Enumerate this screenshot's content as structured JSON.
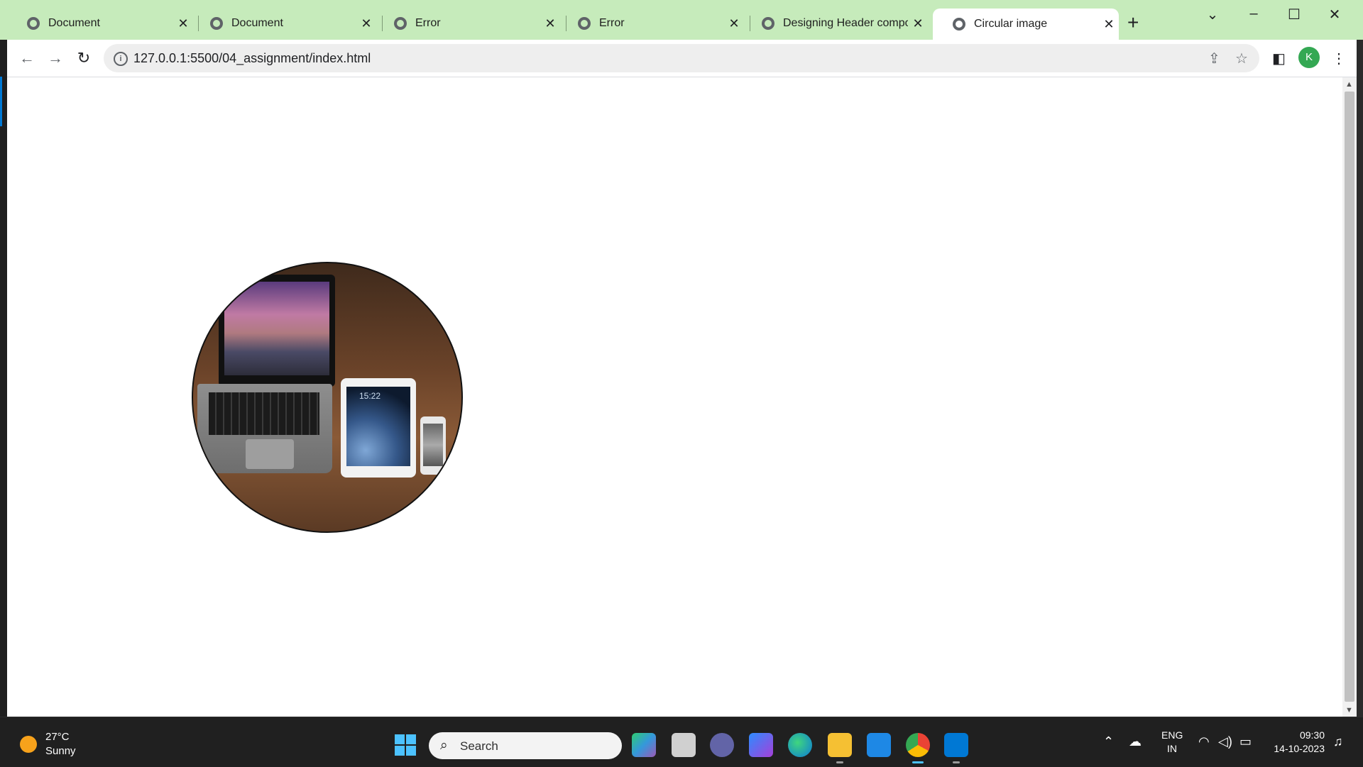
{
  "browser": {
    "tabs": [
      {
        "title": "Document",
        "close": "✕"
      },
      {
        "title": "Document",
        "close": "✕"
      },
      {
        "title": "Error",
        "close": "✕"
      },
      {
        "title": "Error",
        "close": "✕"
      },
      {
        "title": "Designing Header compor",
        "close": "✕"
      },
      {
        "title": "Circular image",
        "close": "✕"
      }
    ],
    "new_tab": "+",
    "url": "127.0.0.1:5500/04_assignment/index.html",
    "profile_initial": "K",
    "info_glyph": "i",
    "colors": {
      "tab_strip": "#c6ebbb",
      "profile": "#34a853"
    }
  },
  "page": {
    "tablet_clock": "15:22"
  },
  "taskbar": {
    "weather_temp": "27°C",
    "weather_desc": "Sunny",
    "search_label": "Search",
    "lang_top": "ENG",
    "lang_bottom": "IN",
    "time": "09:30",
    "date": "14-10-2023"
  }
}
